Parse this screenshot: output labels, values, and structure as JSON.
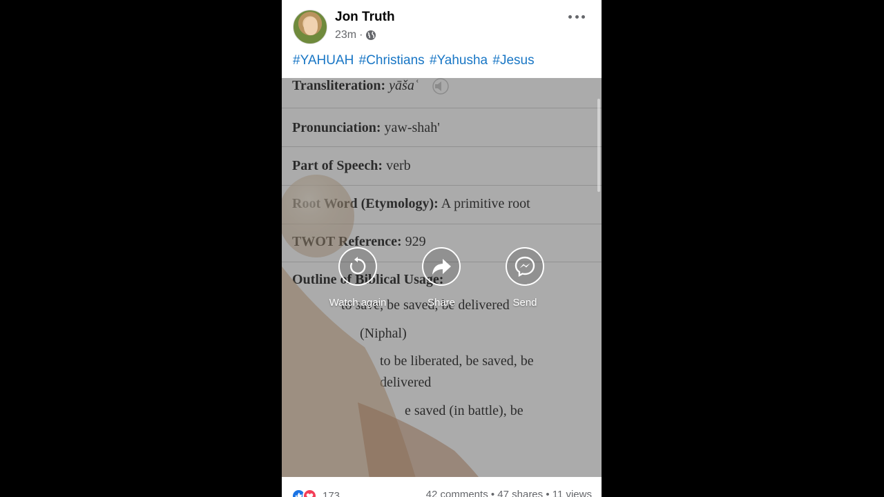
{
  "post": {
    "author": "Jon Truth",
    "time": "23m",
    "time_separator": "·",
    "hashtags": [
      "#YAHUAH",
      "#Christians",
      "#Yahusha",
      "#Jesus"
    ]
  },
  "video_text": {
    "transliteration_label": "Transliteration:",
    "transliteration_value": "yāšaʿ",
    "pronunciation_label": "Pronunciation:",
    "pronunciation_value": "yaw-shah'",
    "part_of_speech_label": "Part of Speech:",
    "part_of_speech_value": "verb",
    "root_word_label": "Root Word (Etymology):",
    "root_word_value": "A primitive root",
    "twot_label": "TWOT Reference:",
    "twot_value": "929",
    "outline_label": "Outline of Biblical Usage:",
    "usage_1": "to save, be saved, be delivered",
    "usage_A": "(Niphal)",
    "usage_A_i_1": "to be liberated, be saved, be",
    "usage_A_i_2": "delivered",
    "usage_A_ii": "e saved (in battle), be"
  },
  "overlay_actions": {
    "watch_again": "Watch again",
    "share": "Share",
    "send": "Send"
  },
  "footer": {
    "reaction_count": "173",
    "stats": "42 comments • 47 shares • 11 views"
  },
  "colors": {
    "link": "#1876c5",
    "like": "#1b74e4",
    "love": "#f33e58"
  }
}
